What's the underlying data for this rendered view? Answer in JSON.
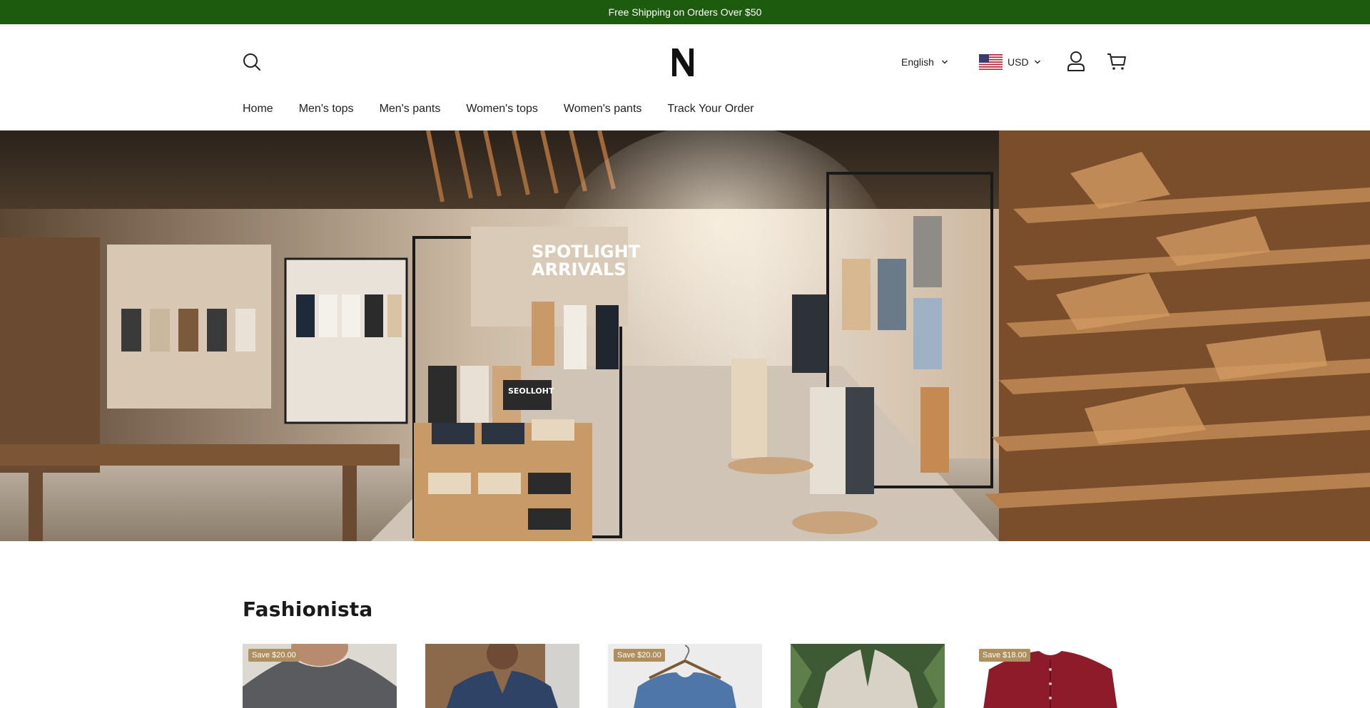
{
  "announcement": {
    "text": "Free Shipping on Orders Over $50"
  },
  "header": {
    "logo_text": "N",
    "language": {
      "selected": "English"
    },
    "currency": {
      "selected": "USD"
    },
    "icons": [
      "search-icon",
      "account-icon",
      "cart-icon",
      "chevron-down-icon",
      "us-flag-icon"
    ]
  },
  "nav": {
    "items": [
      {
        "label": "Home"
      },
      {
        "label": "Men's tops"
      },
      {
        "label": "Men's pants"
      },
      {
        "label": "Women's tops"
      },
      {
        "label": "Women's pants"
      },
      {
        "label": "Track Your Order"
      }
    ]
  },
  "hero": {
    "sign_line1": "SPOTLIGHT",
    "sign_line2": "ARRIVALS",
    "small_sign": "SEOLLOHT"
  },
  "section": {
    "title": "Fashionista"
  },
  "products": [
    {
      "badge": "Save $20.00",
      "image": "grey t-shirt"
    },
    {
      "badge": "",
      "image": "navy short-sleeve shirt"
    },
    {
      "badge": "Save $20.00",
      "image": "blue knit t-shirt"
    },
    {
      "badge": "",
      "image": "linen shirt"
    },
    {
      "badge": "Save $18.00",
      "image": "burgundy henley shirt"
    }
  ],
  "colors": {
    "announcement_bg": "#1d5c0e",
    "badge_bg": "#b08f5f",
    "text": "#222222"
  }
}
